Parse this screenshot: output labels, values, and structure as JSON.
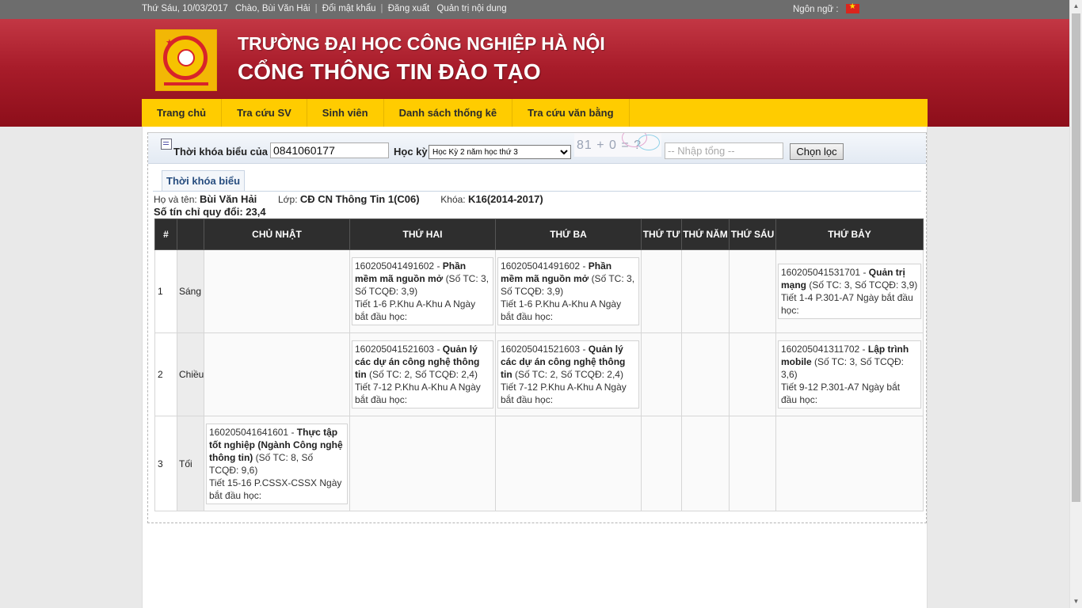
{
  "topbar": {
    "date": "Thứ Sáu, 10/03/2017",
    "greeting": "Chào, Bùi Văn Hải",
    "change_password": "Đổi mật khẩu",
    "logout": "Đăng xuất",
    "admin": "Quản trị nội dung",
    "language_label": "Ngôn ngữ :"
  },
  "header": {
    "title1": "TRƯỜNG ĐẠI HỌC CÔNG NGHIỆP HÀ NỘI",
    "title2": "CỔNG THÔNG TIN ĐÀO TẠO"
  },
  "nav": [
    "Trang chủ",
    "Tra cứu SV",
    "Sinh viên",
    "Danh sách thống kê",
    "Tra cứu văn bằng"
  ],
  "filter": {
    "label": "Thời khóa biểu của",
    "student_id": "0841060177",
    "semester_label": "Học kỳ",
    "semester_value": "Học Kỳ 2 năm học thứ 3",
    "captcha_text": "81 + 0 = ?",
    "captcha_placeholder": "-- Nhập tổng --",
    "submit": "Chọn lọc"
  },
  "tab": "Thời khóa biểu",
  "student": {
    "name_label": "Họ và tên:",
    "name": "Bùi Văn Hải",
    "class_label": "Lớp:",
    "class": "CĐ CN Thông Tin 1(C06)",
    "course_label": "Khóa:",
    "course": "K16(2014-2017)",
    "credits": "Số tín chỉ quy đổi: 23,4"
  },
  "table": {
    "headers": [
      "#",
      "",
      "CHỦ NHẬT",
      "THỨ HAI",
      "THỨ BA",
      "THỨ TƯ",
      "THỨ NĂM",
      "THỨ SÁU",
      "THỨ BẢY"
    ],
    "rows": [
      {
        "num": "1",
        "session": "Sáng",
        "cells": [
          null,
          {
            "code": "160205041491602",
            "name": "Phần mềm mã nguồn mở",
            "detail": "(Số TC: 3, Số TCQĐ: 3,9)",
            "time": "Tiết 1-6 P.Khu A-Khu A Ngày bắt đầu học:"
          },
          {
            "code": "160205041491602",
            "name": "Phần mềm mã nguồn mở",
            "detail": "(Số TC: 3, Số TCQĐ: 3,9)",
            "time": "Tiết 1-6 P.Khu A-Khu A Ngày bắt đầu học:"
          },
          null,
          null,
          null,
          {
            "code": "160205041531701",
            "name": "Quản trị mạng",
            "detail": "(Số TC: 3, Số TCQĐ: 3,9)",
            "time": "Tiết 1-4 P.301-A7 Ngày bắt đầu học:"
          }
        ]
      },
      {
        "num": "2",
        "session": "Chiều",
        "cells": [
          null,
          {
            "code": "160205041521603",
            "name": "Quản lý các dự án công nghệ thông tin",
            "detail": "(Số TC: 2, Số TCQĐ: 2,4)",
            "time": "Tiết 7-12 P.Khu A-Khu A Ngày bắt đầu học:"
          },
          {
            "code": "160205041521603",
            "name": "Quản lý các dự án công nghệ thông tin",
            "detail": "(Số TC: 2, Số TCQĐ: 2,4)",
            "time": "Tiết 7-12 P.Khu A-Khu A Ngày bắt đầu học:"
          },
          null,
          null,
          null,
          {
            "code": "160205041311702",
            "name": "Lập trình mobile",
            "detail": "(Số TC: 3, Số TCQĐ: 3,6)",
            "time": "Tiết 9-12 P.301-A7 Ngày bắt đầu học:"
          }
        ]
      },
      {
        "num": "3",
        "session": "Tối",
        "cells": [
          {
            "code": "160205041641601",
            "name": "Thực tập tốt nghiệp (Ngành Công nghệ thông tin)",
            "detail": "(Số TC: 8, Số TCQĐ: 9,6)",
            "time": "Tiết 15-16 P.CSSX-CSSX Ngày bắt đầu học:"
          },
          null,
          null,
          null,
          null,
          null,
          null
        ]
      }
    ]
  },
  "colors": {
    "header_red": "#a81c2a",
    "nav_yellow": "#ffcc00",
    "table_header": "#2e2e2e",
    "topbar_gray": "#6d6d6d"
  }
}
